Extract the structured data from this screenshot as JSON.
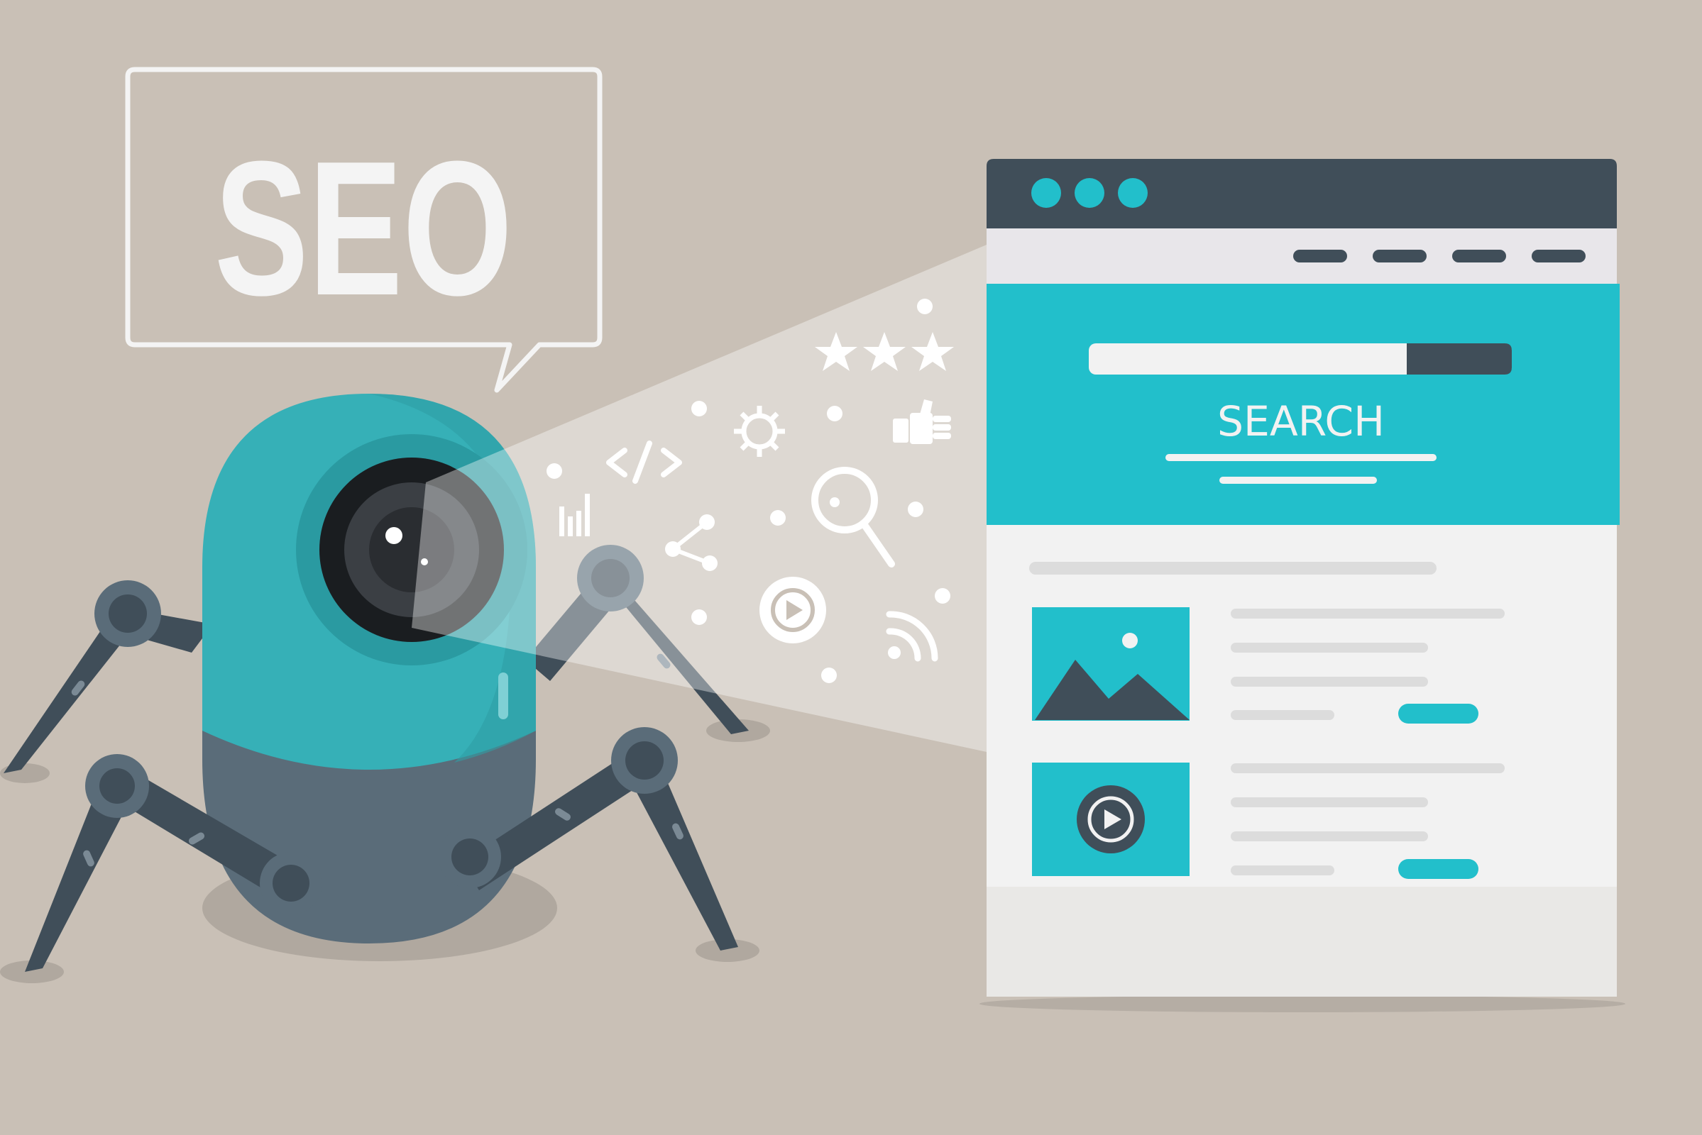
{
  "speech_bubble": {
    "text": "SEO"
  },
  "browser": {
    "window_dots": [
      "dot-1",
      "dot-2",
      "dot-3"
    ],
    "nav_items": [
      "nav-1",
      "nav-2",
      "nav-3",
      "nav-4"
    ],
    "search_button_label": "SEARCH",
    "content_cards": [
      {
        "media": "image-icon"
      },
      {
        "media": "play-icon"
      }
    ]
  },
  "floating_icons": [
    "star-icon",
    "star-icon",
    "star-icon",
    "code-icon",
    "gear-icon",
    "thumbs-up-icon",
    "bar-chart-icon",
    "magnifier-icon",
    "share-icon",
    "play-icon",
    "rss-icon"
  ],
  "colors": {
    "background": "#c9c0b6",
    "teal": "#22bfcb",
    "robot_teal": "#36b0b7",
    "dark_slate": "#404e59",
    "robot_body_dark": "#5a6c79",
    "page_white": "#f2f2f2"
  }
}
